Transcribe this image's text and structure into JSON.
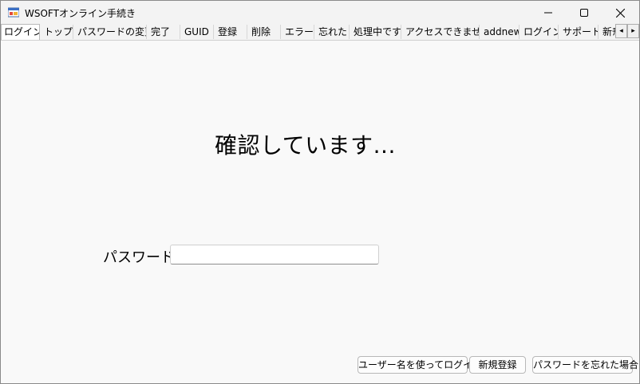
{
  "window": {
    "title": "WSOFTオンライン手続き",
    "app_icon": "windows-form-icon",
    "controls": [
      "minimize-icon",
      "maximize-icon",
      "close-icon"
    ]
  },
  "tabs": [
    {
      "label": "ログイン",
      "active": true
    },
    {
      "label": "トップ"
    },
    {
      "label": "パスワードの変更"
    },
    {
      "label": "完了"
    },
    {
      "label": "GUID"
    },
    {
      "label": "登録"
    },
    {
      "label": "削除"
    },
    {
      "label": "エラー"
    },
    {
      "label": "忘れた"
    },
    {
      "label": "処理中です"
    },
    {
      "label": "アクセスできません"
    },
    {
      "label": "addnew"
    },
    {
      "label": "ログイン"
    },
    {
      "label": "サポート"
    },
    {
      "label": "新ﾁ"
    }
  ],
  "tab_scroll": {
    "left": "◂",
    "right": "▸"
  },
  "main": {
    "heading": "確認しています...",
    "password_label": "パスワード",
    "password_value": ""
  },
  "buttons": {
    "login_with_username": "ユーザー名を使ってログイン",
    "new_registration": "新規登録",
    "forgot_password": "パスワードを忘れた場合"
  }
}
